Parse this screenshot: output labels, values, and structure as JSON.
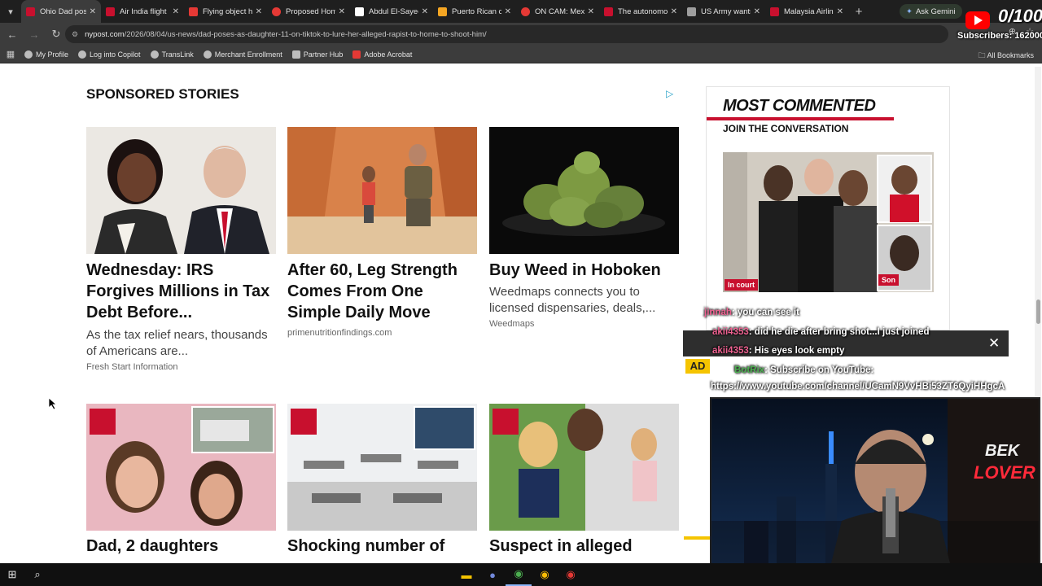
{
  "browser": {
    "tabs": [
      {
        "label": "Ohio Dad poses",
        "color": "#c8102e",
        "active": true
      },
      {
        "label": "Air India flight",
        "color": "#c8102e"
      },
      {
        "label": "Flying object h",
        "color": "#e53935"
      },
      {
        "label": "Proposed Hom",
        "color": "#e53935"
      },
      {
        "label": "Abdul El-Sayed",
        "color": "#ffffff"
      },
      {
        "label": "Puerto Rican ci",
        "color": "#f5a623"
      },
      {
        "label": "ON CAM: Mex",
        "color": "#e53935"
      },
      {
        "label": "The autonomo",
        "color": "#c8102e"
      },
      {
        "label": "US Army wants",
        "color": "#9e9e9e"
      },
      {
        "label": "Malaysia Airlin",
        "color": "#c8102e"
      }
    ],
    "new_tab": "+",
    "gemini_label": "Ask Gemini",
    "url_host": "nypost.com",
    "url_path": "/2026/08/04/us-news/dad-poses-as-daughter-11-on-tiktok-to-lure-her-alleged-rapist-to-home-to-shoot-him/",
    "bookmarks": [
      "My Profile",
      "Log into Copilot",
      "TransLink",
      "Merchant Enrollment",
      "Partner Hub",
      "Adobe Acrobat"
    ],
    "all_bookmarks": "All Bookmarks"
  },
  "page": {
    "sponsored_heading": "SPONSORED STORIES",
    "cards": [
      {
        "title": "Wednesday: IRS Forgives Millions in Tax Debt Before...",
        "desc": "As the tax relief nears, thousands of Americans are...",
        "source": "Fresh Start Information"
      },
      {
        "title": "After 60, Leg Strength Comes From One Simple Daily Move",
        "desc": "",
        "source": "primenutritionfindings.com"
      },
      {
        "title": "Buy Weed in Hoboken",
        "desc": "Weedmaps connects you to licensed dispensaries, deals,...",
        "source": "Weedmaps"
      }
    ],
    "bottom_cards": [
      {
        "title": "Dad, 2 daughters"
      },
      {
        "title": "Shocking number of"
      },
      {
        "title": "Suspect in alleged"
      }
    ],
    "sidebar": {
      "title": "MOST COMMENTED",
      "subtitle": "JOIN THE CONVERSATION",
      "badge_left": "In court",
      "badge_right": "Son"
    }
  },
  "stream": {
    "subscriber_progress": "0/100",
    "subscribers_label": "Subscribers: 162000",
    "ad_label": "AD",
    "chat": [
      {
        "user": "jinnah",
        "text": ": you can see it"
      },
      {
        "user": "akii4353",
        "text": ": did he die after bring shot...I just joined"
      },
      {
        "user": "akii4353",
        "text": ": His eyes look empty"
      },
      {
        "user": "BotRix",
        "text": ": Subscribe on YouTube:"
      },
      {
        "user": "",
        "text": "https://www.youtube.com/channel/UCamN9VvHBi53ZT6QyiHHgcA"
      }
    ],
    "neon_text_1": "BEK",
    "neon_text_2": "LOVER"
  }
}
